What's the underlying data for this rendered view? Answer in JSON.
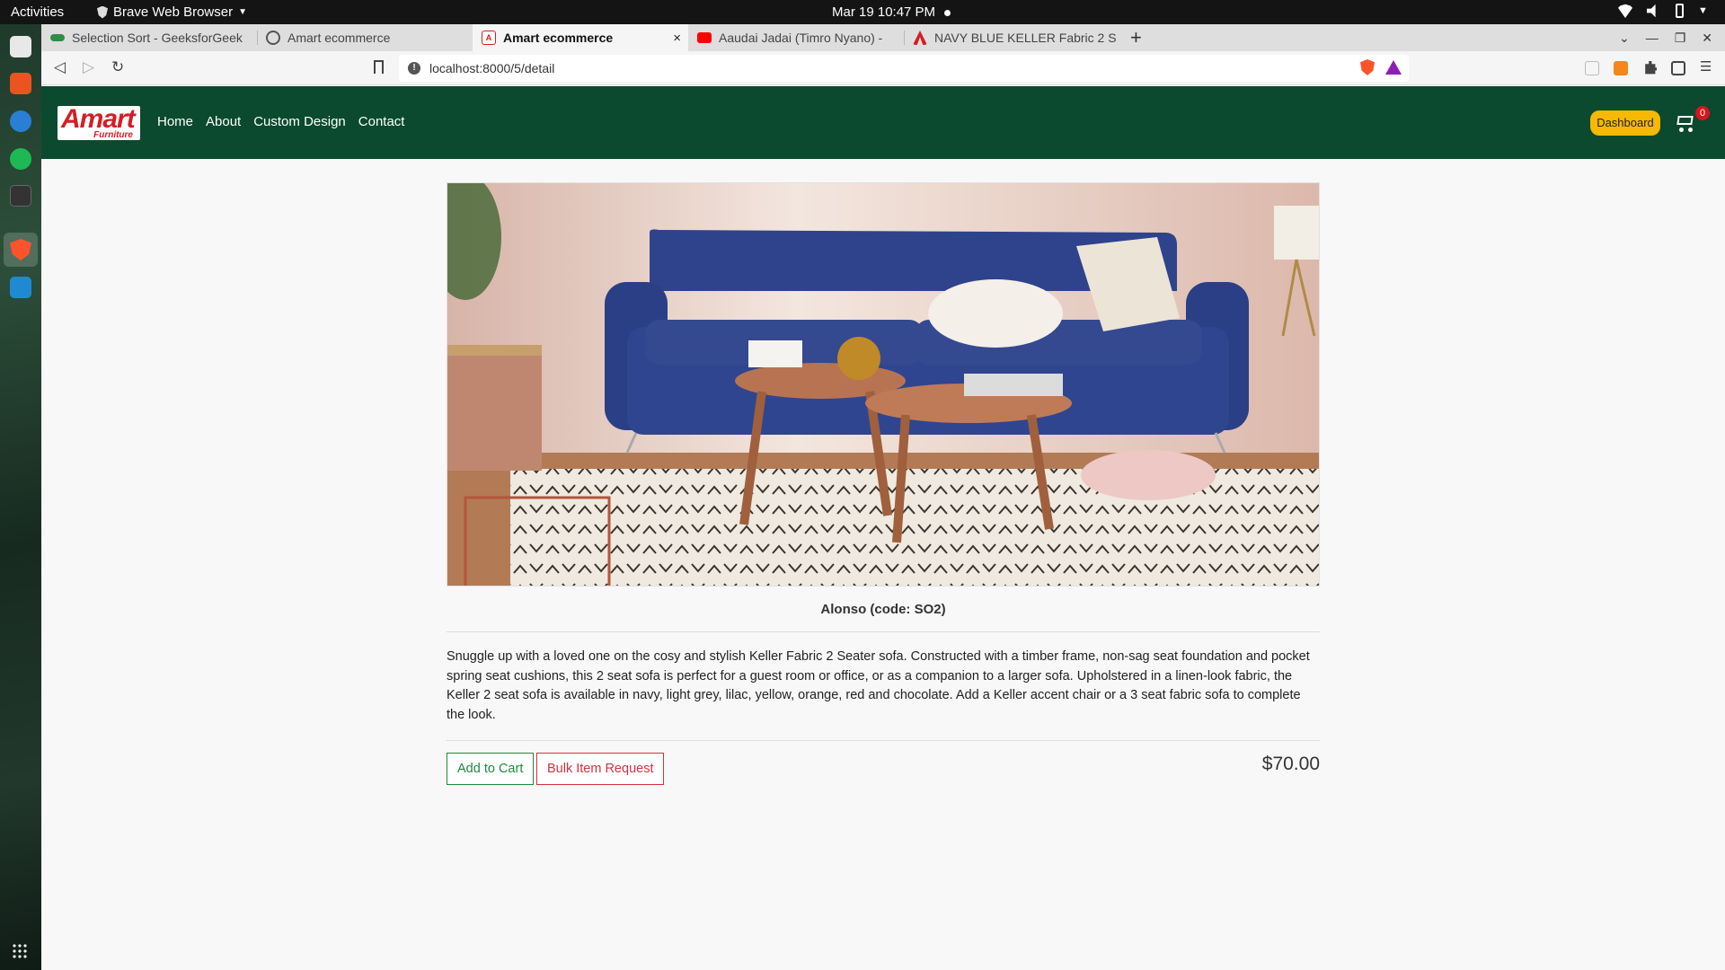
{
  "system": {
    "activities": "Activities",
    "app_name": "Brave Web Browser",
    "clock": "Mar 19  10:47 PM"
  },
  "tabs": [
    {
      "label": "Selection Sort - GeeksforGeek",
      "icon": "geeksforgeeks-icon"
    },
    {
      "label": "Amart ecommerce",
      "icon": "globe-icon"
    },
    {
      "label": "Amart ecommerce",
      "icon": "amart-icon",
      "active": true
    },
    {
      "label": "Aaudai Jadai (Timro Nyano) -",
      "icon": "youtube-icon"
    },
    {
      "label": "NAVY BLUE KELLER Fabric 2 S",
      "icon": "amart-icon"
    }
  ],
  "tab_close": "×",
  "new_tab": "+",
  "address_bar": {
    "url": "localhost:8000/5/detail"
  },
  "site": {
    "logo_word": "Amart",
    "logo_sub": "Furniture",
    "menu": [
      "Home",
      "About",
      "Custom Design",
      "Contact"
    ],
    "dashboard_label": "Dashboard",
    "cart_count": "0"
  },
  "product": {
    "name": "Alonso (code: SO2)",
    "description": "Snuggle up with a loved one on the cosy and stylish Keller Fabric 2 Seater sofa. Constructed with a timber frame, non-sag seat foundation and pocket spring seat cushions, this 2 seat sofa is perfect for a guest room or office, or as a companion to a larger sofa. Upholstered in a linen-look fabric, the Keller 2 seat sofa is available in navy, light grey, lilac, yellow, orange, red and chocolate. Add a Keller accent chair or a 3 seat fabric sofa to complete the look.",
    "add_to_cart": "Add to Cart",
    "bulk_request": "Bulk Item Request",
    "price": "$70.00"
  },
  "colors": {
    "navbar": "#0b4a2f",
    "dashboard": "#f6b800",
    "add_to_cart": "#1e8a3e",
    "bulk_request": "#d5303f",
    "sofa": "#2b3f86"
  }
}
